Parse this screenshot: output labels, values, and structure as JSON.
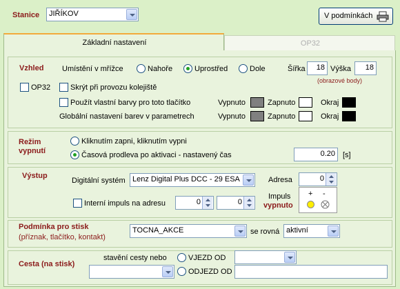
{
  "header": {
    "station_label": "Stanice",
    "station_value": "JIŘÍKOV",
    "conditions_button": "V podmínkách"
  },
  "tabs": [
    {
      "label": "Základní nastavení",
      "active": true
    },
    {
      "label": "OP32",
      "active": false
    }
  ],
  "vzhled": {
    "title": "Vzhled",
    "grid_label": "Umístění v mřížce",
    "positions": [
      {
        "label": "Nahoře",
        "checked": false
      },
      {
        "label": "Uprostřed",
        "checked": true
      },
      {
        "label": "Dole",
        "checked": false
      }
    ],
    "width_label": "Šířka",
    "width_value": "18",
    "height_label": "Výška",
    "height_value": "18",
    "units_note": "(obrazové body)",
    "op32_label": "OP32",
    "hide_label": "Skrýt při provozu kolejiště",
    "own_colors_label": "Použít vlastní barvy pro toto tlačítko",
    "global_colors_label": "Globální nastavení barev v parametrech",
    "off_label": "Vypnuto",
    "on_label": "Zapnuto",
    "border_label": "Okraj",
    "colors": {
      "off": "#808080",
      "on": "#ffffff",
      "border": "#000000"
    }
  },
  "rezim": {
    "title_line1": "Režim",
    "title_line2": "vypnutí",
    "options": [
      {
        "label": "Kliknutím zapni, kliknutím vypni",
        "checked": false
      },
      {
        "label": "Časová prodleva po aktivaci - nastavený čas",
        "checked": true
      }
    ],
    "delay_value": "0.20",
    "delay_unit": "[s]"
  },
  "vystup": {
    "title": "Výstup",
    "digital_label": "Digitální systém",
    "digital_value": "Lenz Digital Plus DCC - 29 ESA",
    "address_label": "Adresa",
    "address_value": "0",
    "internal_label": "Interní impuls na adresu",
    "internal_a": "0",
    "internal_b": "0",
    "impulse_label_1": "Impuls",
    "impulse_label_2": "vypnuto",
    "plus": "+",
    "minus": "-"
  },
  "podminka": {
    "title": "Podmínka pro stisk",
    "subtitle": "(příznak, tlačítko, kontakt)",
    "condition_value": "TOCNA_AKCE",
    "equals_label": "se rovná",
    "state_value": "aktivní"
  },
  "cesta": {
    "title": "Cesta (na stisk)",
    "route_label": "stavění cesty nebo",
    "entry_label": "VJEZD OD",
    "exit_label": "ODJEZD OD",
    "route_value": "",
    "entry_value": "",
    "exit_value": ""
  }
}
